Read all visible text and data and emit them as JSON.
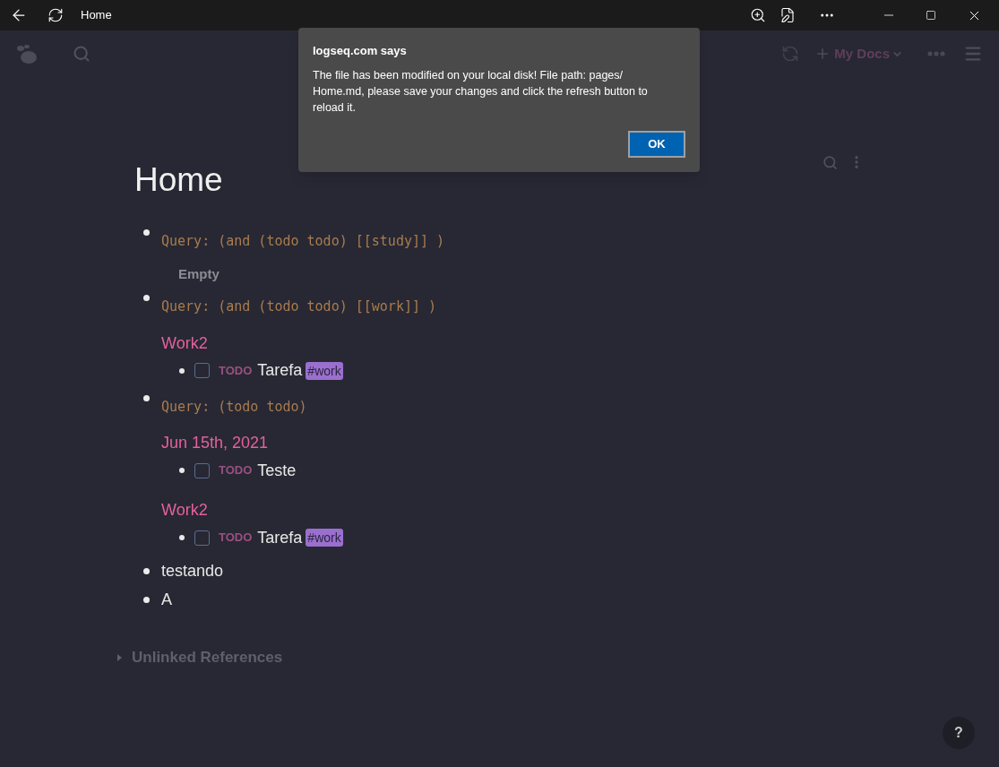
{
  "window": {
    "title": "Home"
  },
  "header": {
    "graph_name": "My Docs"
  },
  "page": {
    "title": "Home",
    "blocks": [
      {
        "kind": "query",
        "query": "Query: (and (todo todo) [[study]] )",
        "empty_text": "Empty"
      },
      {
        "kind": "query",
        "query": "Query: (and (todo todo) [[work]] )",
        "groups": [
          {
            "page": "Work2",
            "tasks": [
              {
                "marker": "TODO",
                "checked": false,
                "text": "Tarefa",
                "tag": "#work"
              }
            ]
          }
        ]
      },
      {
        "kind": "query",
        "query": "Query: (todo todo)",
        "groups": [
          {
            "page": "Jun 15th, 2021",
            "tasks": [
              {
                "marker": "TODO",
                "checked": false,
                "text": "Teste"
              }
            ]
          },
          {
            "page": "Work2",
            "tasks": [
              {
                "marker": "TODO",
                "checked": false,
                "text": "Tarefa",
                "tag": "#work"
              }
            ]
          }
        ]
      },
      {
        "kind": "text",
        "text": "testando"
      },
      {
        "kind": "text",
        "text": "A"
      }
    ],
    "unlinked_references": {
      "label": "Unlinked References",
      "expanded": false
    }
  },
  "help_button": "?",
  "dialog": {
    "title": "logseq.com says",
    "message": "The file has been modified on your local disk! File path: pages/ Home.md, please save your changes and click the refresh button to reload it.",
    "button": "OK"
  }
}
